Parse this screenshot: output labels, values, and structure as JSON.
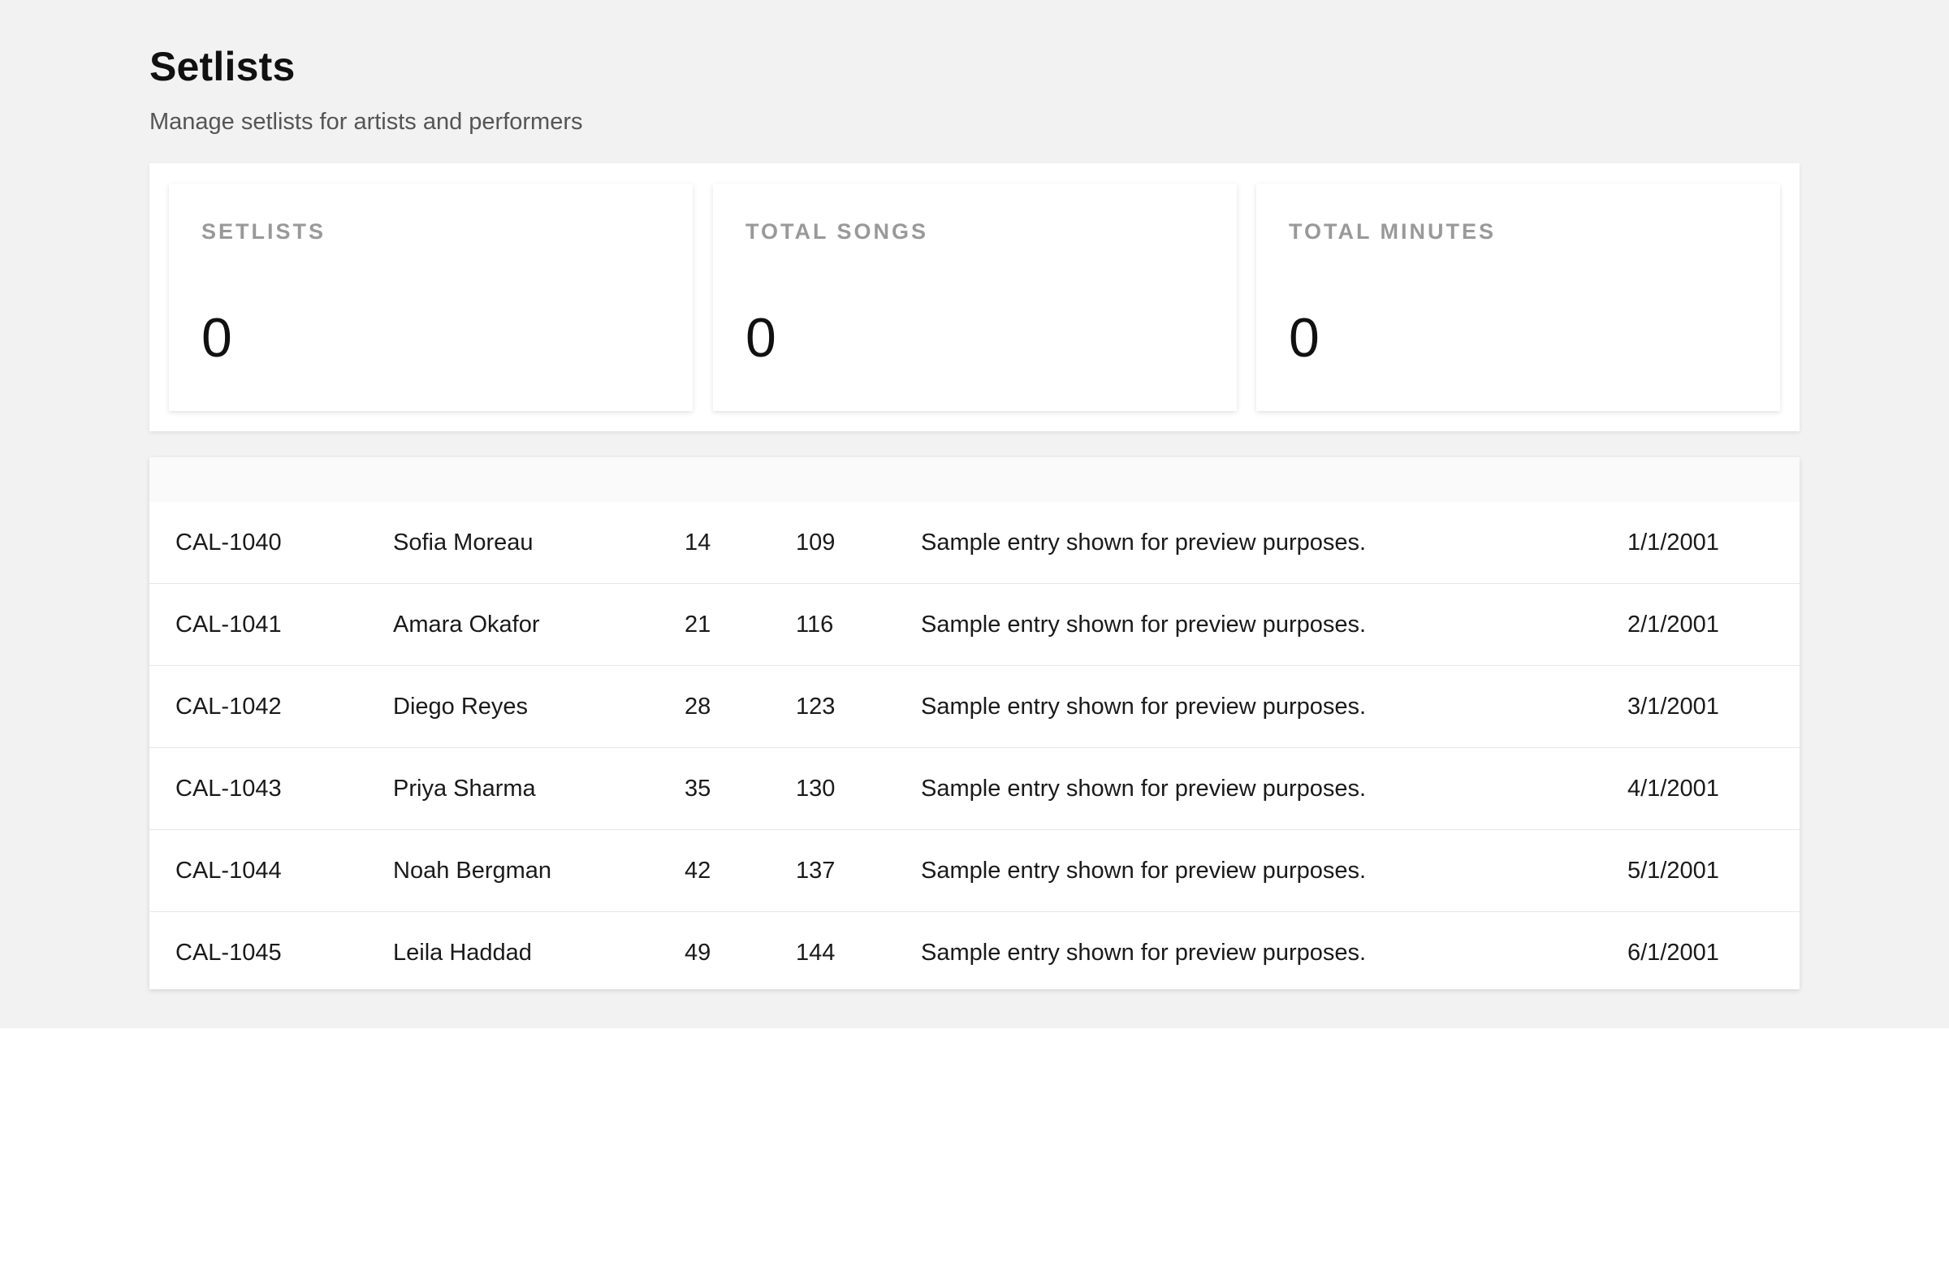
{
  "header": {
    "title": "Setlists",
    "subtitle": "Manage setlists for artists and performers"
  },
  "stats": [
    {
      "label": "SETLISTS",
      "value": "0"
    },
    {
      "label": "TOTAL SONGS",
      "value": "0"
    },
    {
      "label": "TOTAL MINUTES",
      "value": "0"
    }
  ],
  "table": {
    "rows": [
      {
        "id": "CAL-1040",
        "name": "Sofia Moreau",
        "songs": "14",
        "minutes": "109",
        "notes": "Sample entry shown for preview purposes.",
        "date": "1/1/2001"
      },
      {
        "id": "CAL-1041",
        "name": "Amara Okafor",
        "songs": "21",
        "minutes": "116",
        "notes": "Sample entry shown for preview purposes.",
        "date": "2/1/2001"
      },
      {
        "id": "CAL-1042",
        "name": "Diego Reyes",
        "songs": "28",
        "minutes": "123",
        "notes": "Sample entry shown for preview purposes.",
        "date": "3/1/2001"
      },
      {
        "id": "CAL-1043",
        "name": "Priya Sharma",
        "songs": "35",
        "minutes": "130",
        "notes": "Sample entry shown for preview purposes.",
        "date": "4/1/2001"
      },
      {
        "id": "CAL-1044",
        "name": "Noah Bergman",
        "songs": "42",
        "minutes": "137",
        "notes": "Sample entry shown for preview purposes.",
        "date": "5/1/2001"
      },
      {
        "id": "CAL-1045",
        "name": "Leila Haddad",
        "songs": "49",
        "minutes": "144",
        "notes": "Sample entry shown for preview purposes.",
        "date": "6/1/2001"
      }
    ]
  }
}
